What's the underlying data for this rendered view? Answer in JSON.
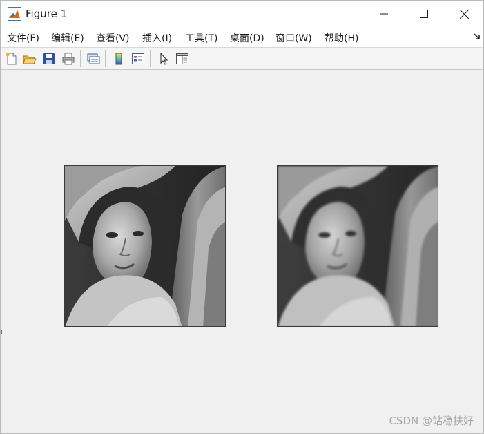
{
  "window": {
    "title": "Figure 1",
    "icon": "matlab-figure-icon"
  },
  "menu": {
    "items": [
      {
        "label": "文件(F)"
      },
      {
        "label": "编辑(E)"
      },
      {
        "label": "查看(V)"
      },
      {
        "label": "插入(I)"
      },
      {
        "label": "工具(T)"
      },
      {
        "label": "桌面(D)"
      },
      {
        "label": "窗口(W)"
      },
      {
        "label": "帮助(H)"
      }
    ]
  },
  "toolbar": {
    "buttons": [
      {
        "icon": "new-figure-icon"
      },
      {
        "icon": "open-file-icon"
      },
      {
        "icon": "save-icon"
      },
      {
        "icon": "print-icon"
      },
      {
        "icon": "link-plot-icon"
      },
      {
        "icon": "insert-colorbar-icon"
      },
      {
        "icon": "insert-legend-icon"
      },
      {
        "icon": "edit-plot-pointer-icon"
      },
      {
        "icon": "property-inspector-icon"
      }
    ]
  },
  "figure": {
    "images": [
      {
        "name": "original-image",
        "content": "grayscale portrait photograph"
      },
      {
        "name": "blurred-image",
        "content": "grayscale portrait photograph, smoothed"
      }
    ]
  },
  "watermark": "CSDN @站稳扶好"
}
